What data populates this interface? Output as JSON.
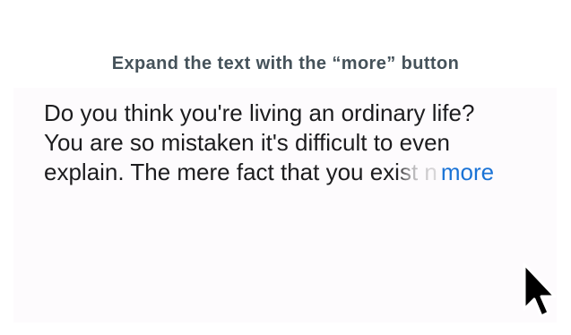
{
  "caption": "Expand the text with the “more” button",
  "text": {
    "line1": "Do you think you're living an ordinary life?",
    "line2": "You are so mistaken it's difficult to even",
    "line3": "explain. The mere fact that you exist n",
    "more_label": "more"
  },
  "colors": {
    "caption": "#45525a",
    "body_text": "#1c1c1e",
    "link": "#1a73d6",
    "card_background": "#fdfbfd"
  },
  "icons": {
    "cursor": "mouse-pointer-arrow"
  }
}
